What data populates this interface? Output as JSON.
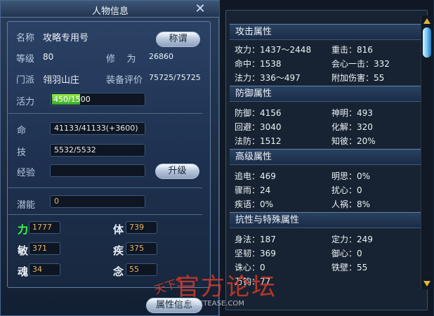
{
  "left": {
    "title": "人物信息",
    "name_label": "名称",
    "name": "攻略专用号",
    "title_button": "称谓",
    "level_label": "等级",
    "level": "80",
    "cultivation_label": "修    为",
    "cultivation": "26860",
    "faction_label": "门派",
    "faction": "翎羽山庄",
    "equip_label": "装备评价",
    "equip": "75725/75725",
    "energy_label": "活力",
    "energy": "450/1500",
    "energy_fraction": 0.3,
    "life_label": "命",
    "life": "41133/41133(+3600)",
    "skill_label": "技",
    "skill": "5532/5532",
    "exp_label": "经验",
    "exp": "",
    "upgrade_button": "升级",
    "potential_label": "潜能",
    "potential": "0",
    "stats": [
      {
        "label": "力",
        "value": "1777"
      },
      {
        "label": "体",
        "value": "739"
      },
      {
        "label": "敏",
        "value": "371"
      },
      {
        "label": "疾",
        "value": "375"
      },
      {
        "label": "魂",
        "value": "34"
      },
      {
        "label": "念",
        "value": "55"
      }
    ],
    "attributes_button": "属性信息"
  },
  "right": {
    "sections": [
      {
        "title": "攻击属性",
        "rows": [
          [
            "攻力：1437～2448",
            "重击：816"
          ],
          [
            "命中：1538",
            "会心一击：332"
          ],
          [
            "法力：336～497",
            "附加伤害：55"
          ]
        ]
      },
      {
        "title": "防御属性",
        "rows": [
          [
            "防御：4156",
            "神明：493"
          ],
          [
            "回避：3040",
            "化解：320"
          ],
          [
            "法防：1512",
            "知彼：20%"
          ]
        ]
      },
      {
        "title": "高级属性",
        "rows": [
          [
            "追电：469",
            "明思：0%"
          ],
          [
            "骤雨：24",
            "扰心：0"
          ],
          [
            "疾语：0%",
            "人祸：8%"
          ]
        ]
      },
      {
        "title": "抗性与特殊属性",
        "rows": [
          [
            "身法：187",
            "定力：249"
          ],
          [
            "坚韧：369",
            "御心：0"
          ],
          [
            "诛心：0",
            "铁壁：55"
          ],
          [
            "万钧：77",
            ""
          ]
        ]
      }
    ]
  },
  "watermark": {
    "glyph": "天下3",
    "brand": "官方论坛",
    "url": "TX3.NETEASE.COM"
  },
  "colors": {
    "accent": "#e9b36b",
    "power": "#37ff47",
    "energy_bar": "#61d23b"
  }
}
